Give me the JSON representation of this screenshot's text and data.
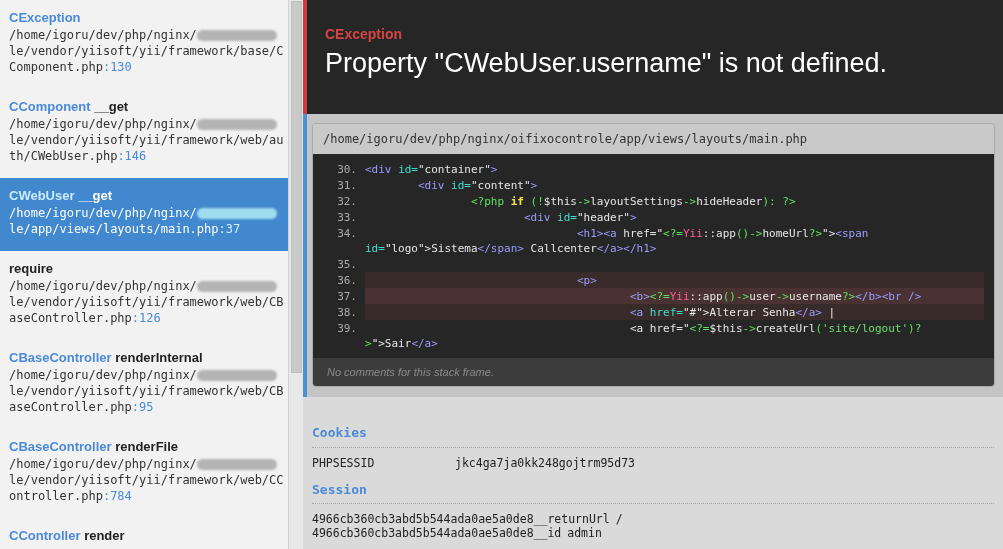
{
  "frames": [
    {
      "class": "CException",
      "path_start": "/home/igoru/dev/php/nginx/",
      "redacted": true,
      "path_end": "le/vendor/yiisoft/yii/framework/base/CComponent.php",
      "line": ":130",
      "selected": false
    },
    {
      "class": "CComponent",
      "function": "__get",
      "path_start": "/home/igoru/dev/php/nginx/",
      "redacted": true,
      "path_end": "le/vendor/yiisoft/yii/framework/web/auth/CWebUser.php",
      "line": ":146",
      "selected": false
    },
    {
      "class": "CWebUser",
      "function": "__get",
      "path_start": "/home/igoru/dev/php/nginx/",
      "redacted": true,
      "path_end": "le/app/views/layouts/main.php",
      "line": ":37",
      "selected": true
    },
    {
      "function": "require",
      "path_start": "/home/igoru/dev/php/nginx/",
      "redacted": true,
      "path_end": "le/vendor/yiisoft/yii/framework/web/CBaseController.php",
      "line": ":126",
      "selected": false
    },
    {
      "class": "CBaseController",
      "function": "renderInternal",
      "path_start": "/home/igoru/dev/php/nginx/",
      "redacted": true,
      "path_end": "le/vendor/yiisoft/yii/framework/web/CBaseController.php",
      "line": ":95",
      "selected": false
    },
    {
      "class": "CBaseController",
      "function": "renderFile",
      "path_start": "/home/igoru/dev/php/nginx/",
      "redacted": true,
      "path_end": "le/vendor/yiisoft/yii/framework/web/CController.php",
      "line": ":784",
      "selected": false
    },
    {
      "class": "CController",
      "function": "render",
      "selected": false
    }
  ],
  "exception": {
    "type": "CException",
    "message": "Property \"CWebUser.username\" is not defined."
  },
  "code_frame": {
    "file": "/home/igoru/dev/php/nginx/oifixocontrole/app/views/layouts/main.php",
    "lines": [
      {
        "number": "30.",
        "highlighted": false,
        "error_line": false,
        "tokens": [
          {
            "kind": "tag",
            "t": "<div "
          },
          {
            "kind": "attr",
            "t": "id="
          },
          {
            "kind": "text",
            "t": "\"container\""
          },
          {
            "kind": "tag",
            "t": ">"
          }
        ]
      },
      {
        "number": "31.",
        "highlighted": false,
        "error_line": false,
        "tokens": [
          {
            "kind": "tag",
            "t": "        <div "
          },
          {
            "kind": "attr",
            "t": "id="
          },
          {
            "kind": "text",
            "t": "\"content\""
          },
          {
            "kind": "tag",
            "t": ">"
          }
        ]
      },
      {
        "number": "32.",
        "highlighted": false,
        "error_line": false,
        "tokens": [
          {
            "kind": "php",
            "t": "                <?php "
          },
          {
            "kind": "kw",
            "t": "if "
          },
          {
            "kind": "php",
            "t": "(!"
          },
          {
            "kind": "text",
            "t": "$this"
          },
          {
            "kind": "php",
            "t": "->"
          },
          {
            "kind": "text",
            "t": "layoutSettings"
          },
          {
            "kind": "php",
            "t": "->"
          },
          {
            "kind": "text",
            "t": "hideHeader"
          },
          {
            "kind": "php",
            "t": "): ?>"
          }
        ]
      },
      {
        "number": "33.",
        "highlighted": false,
        "error_line": false,
        "tokens": [
          {
            "kind": "tag",
            "t": "                        <div "
          },
          {
            "kind": "attr",
            "t": "id="
          },
          {
            "kind": "text",
            "t": "\"header\""
          },
          {
            "kind": "tag",
            "t": ">"
          }
        ]
      },
      {
        "number": "34.",
        "highlighted": false,
        "error_line": false,
        "tokens": [
          {
            "kind": "tag",
            "t": "                                <h1><a"
          },
          {
            "kind": "text",
            "t": " href=\""
          },
          {
            "kind": "php",
            "t": "<?="
          },
          {
            "kind": "cls",
            "t": "Yii"
          },
          {
            "kind": "text",
            "t": "::app"
          },
          {
            "kind": "php",
            "t": "()->"
          },
          {
            "kind": "text",
            "t": "homeUrl"
          },
          {
            "kind": "php",
            "t": "?>"
          },
          {
            "kind": "text",
            "t": "\">"
          },
          {
            "kind": "tag",
            "t": "<span "
          },
          {
            "kind": "attr",
            "t": "id="
          },
          {
            "kind": "text",
            "t": "\"logo\">Sistema"
          },
          {
            "kind": "tag",
            "t": "</span>"
          },
          {
            "kind": "text",
            "t": " Callcenter"
          },
          {
            "kind": "tag",
            "t": "</a></h1>"
          }
        ]
      },
      {
        "number": "35.",
        "highlighted": false,
        "error_line": false
      },
      {
        "number": "36.",
        "highlighted": true,
        "error_line": false,
        "tokens": [
          {
            "kind": "tag",
            "t": "                                <p>"
          }
        ]
      },
      {
        "number": "37.",
        "highlighted": false,
        "error_line": true,
        "tokens": [
          {
            "kind": "tag",
            "t": "                                        <b>"
          },
          {
            "kind": "php",
            "t": "<?="
          },
          {
            "kind": "cls",
            "t": "Yii"
          },
          {
            "kind": "text",
            "t": "::app"
          },
          {
            "kind": "php",
            "t": "()->"
          },
          {
            "kind": "text",
            "t": "user"
          },
          {
            "kind": "php",
            "t": "->"
          },
          {
            "kind": "text",
            "t": "username"
          },
          {
            "kind": "php",
            "t": "?>"
          },
          {
            "kind": "tag",
            "t": "</b><br />"
          }
        ]
      },
      {
        "number": "38.",
        "highlighted": true,
        "error_line": false,
        "tokens": [
          {
            "kind": "tag",
            "t": "                                        <a "
          },
          {
            "kind": "attr",
            "t": "href="
          },
          {
            "kind": "text",
            "t": "\"#\">Alterar Senha"
          },
          {
            "kind": "tag",
            "t": "</a>"
          },
          {
            "kind": "text",
            "t": " |"
          }
        ]
      },
      {
        "number": "39.",
        "highlighted": false,
        "error_line": false,
        "tokens": [
          {
            "kind": "text",
            "t": "                                        <a href=\""
          },
          {
            "kind": "php",
            "t": "<?="
          },
          {
            "kind": "text",
            "t": "$this"
          },
          {
            "kind": "php",
            "t": "->"
          },
          {
            "kind": "text",
            "t": "createUrl"
          },
          {
            "kind": "php",
            "t": "("
          },
          {
            "kind": "str",
            "t": "'site/logout'"
          },
          {
            "kind": "php",
            "t": ")?>"
          },
          {
            "kind": "text",
            "t": "\">Sair"
          },
          {
            "kind": "tag",
            "t": "</a>"
          }
        ]
      }
    ],
    "comment": "No comments for this stack frame."
  },
  "sections": [
    {
      "title": "Cookies",
      "rows": [
        {
          "key": "PHPSESSID",
          "value": "jkc4ga7ja0kk248gojtrm95d73"
        }
      ]
    },
    {
      "title": "Session",
      "rows": [
        {
          "key": "4966cb360cb3abd5b544ada0ae5a0de8__returnUrl",
          "value": "/"
        },
        {
          "key": "4966cb360cb3abd5b544ada0ae5a0de8__id",
          "value": "admin"
        }
      ]
    }
  ]
}
